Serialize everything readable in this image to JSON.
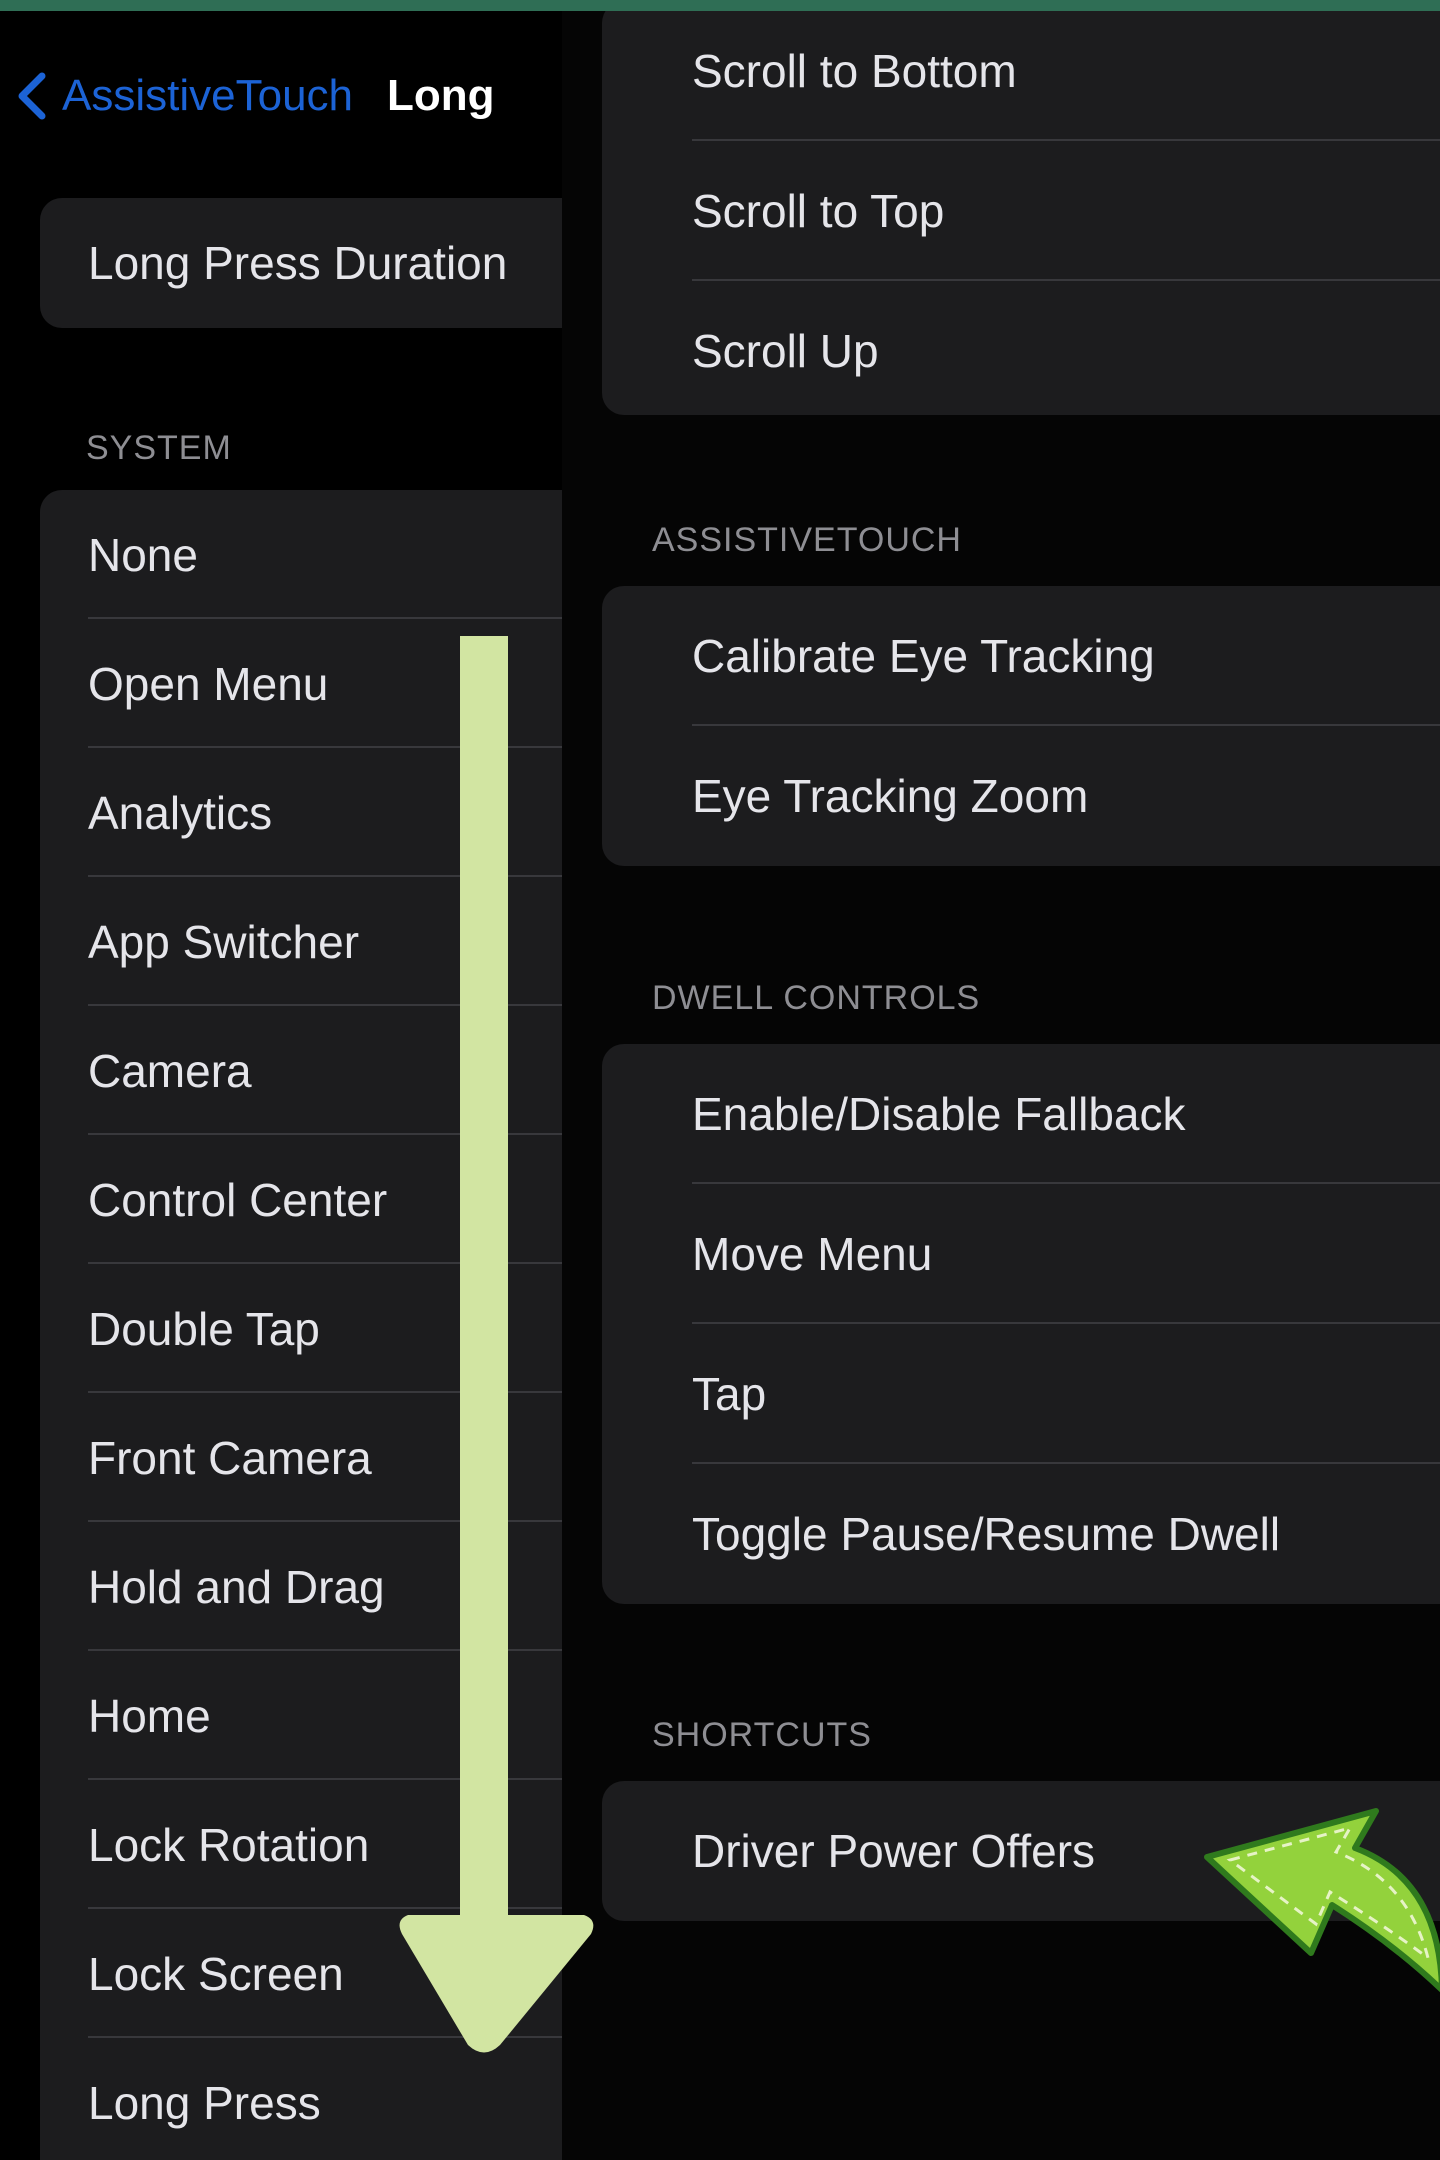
{
  "nav": {
    "back_label": "AssistiveTouch",
    "title": "Long"
  },
  "left": {
    "duration_label": "Long Press Duration",
    "system_header": "SYSTEM",
    "system_items": [
      "None",
      "Open Menu",
      "Analytics",
      "App Switcher",
      "Camera",
      "Control Center",
      "Double Tap",
      "Front Camera",
      "Hold and Drag",
      "Home",
      "Lock Rotation",
      "Lock Screen",
      "Long Press"
    ]
  },
  "right": {
    "scroll_items": [
      "Scroll to Bottom",
      "Scroll to Top",
      "Scroll Up"
    ],
    "assistivetouch_header": "ASSISTIVETOUCH",
    "assistivetouch_items": [
      "Calibrate Eye Tracking",
      "Eye Tracking Zoom"
    ],
    "dwell_header": "DWELL CONTROLS",
    "dwell_items": [
      "Enable/Disable Fallback",
      "Move Menu",
      "Tap",
      "Toggle Pause/Resume Dwell"
    ],
    "shortcuts_header": "SHORTCUTS",
    "shortcuts_items": [
      "Driver Power Offers"
    ]
  },
  "colors": {
    "accent_blue": "#1c63d6",
    "frame_green": "#2f6e55",
    "arrow_light_green": "#d2e5a2",
    "arrow_bright_green": "#93d23c",
    "arrow_outline_green": "#2f7a1d"
  },
  "icons": {
    "back": "chevron-left-icon",
    "down_arrow": "down-arrow-icon",
    "pointer_arrow": "curved-arrow-icon"
  }
}
